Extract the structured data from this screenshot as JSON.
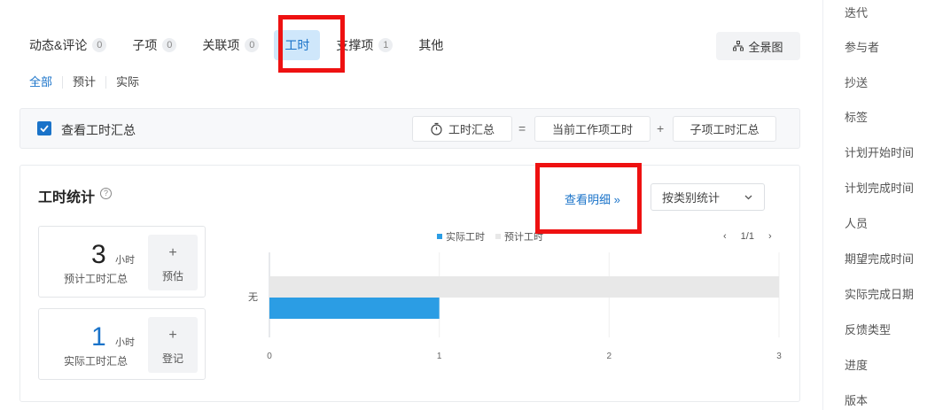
{
  "tabs": [
    {
      "label": "动态&评论",
      "count": "0"
    },
    {
      "label": "子项",
      "count": "0"
    },
    {
      "label": "关联项",
      "count": "0"
    },
    {
      "label": "工时",
      "count": ""
    },
    {
      "label": "支撑项",
      "count": "1"
    },
    {
      "label": "其他",
      "count": ""
    }
  ],
  "active_tab_index": 3,
  "overview_label": "全景图",
  "subtabs": [
    "全部",
    "预计",
    "实际"
  ],
  "summary": {
    "checkbox_label": "查看工时汇总",
    "checked": true,
    "total_label": "工时汇总",
    "equals": "=",
    "current_label": "当前工作项工时",
    "plus": "+",
    "child_label": "子项工时汇总"
  },
  "stats": {
    "title": "工时统计",
    "help": "?",
    "detail_link": "查看明细 »",
    "group_select": "按类别统计",
    "estimated": {
      "value": "3",
      "unit": "小时",
      "label": "预计工时汇总",
      "action_icon": "+",
      "action": "预估"
    },
    "actual": {
      "value": "1",
      "unit": "小时",
      "label": "实际工时汇总",
      "action_icon": "+",
      "action": "登记"
    },
    "pager": {
      "prev": "‹",
      "page": "1/1",
      "next": "›"
    }
  },
  "colors": {
    "accent": "#1a73c9",
    "actual_bar": "#2b9de4",
    "estimate_bar": "#e8e8e8",
    "highlight": "#ee1111"
  },
  "chart_data": {
    "type": "bar",
    "orientation": "horizontal",
    "categories": [
      "无"
    ],
    "series": [
      {
        "name": "实际工时",
        "values": [
          1
        ],
        "color": "#2b9de4"
      },
      {
        "name": "预计工时",
        "values": [
          3
        ],
        "color": "#e8e8e8"
      }
    ],
    "xlim": [
      0,
      3
    ],
    "xticks": [
      0,
      1,
      2,
      3
    ],
    "legend": "top-center",
    "grid": true
  },
  "right_panel": {
    "items": [
      "迭代",
      "参与者",
      "抄送",
      "标签",
      "计划开始时间",
      "计划完成时间",
      "人员",
      "期望完成时间",
      "实际完成日期",
      "反馈类型",
      "进度",
      "版本"
    ]
  }
}
